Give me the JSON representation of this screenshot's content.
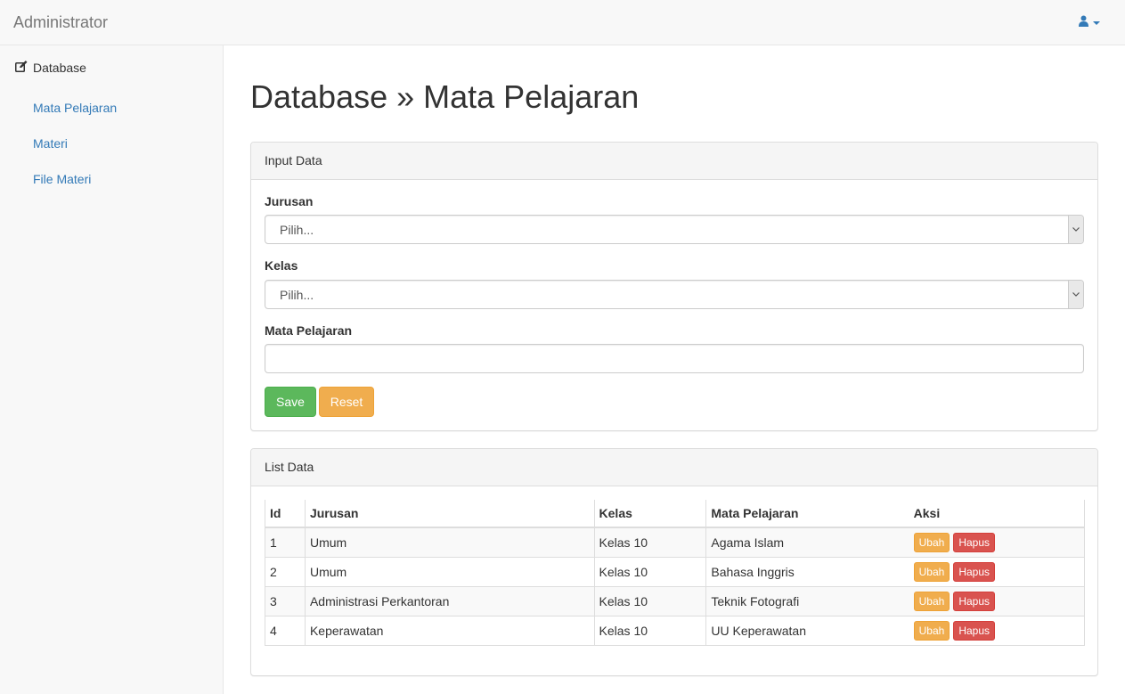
{
  "navbar": {
    "brand": "Administrator",
    "user_icon": "user-icon",
    "caret_icon": "caret-down-icon",
    "accent": "#337ab7"
  },
  "sidebar": {
    "heading": {
      "icon": "edit-icon",
      "label": "Database"
    },
    "items": [
      {
        "label": "Mata Pelajaran"
      },
      {
        "label": "Materi"
      },
      {
        "label": "File Materi"
      }
    ]
  },
  "main": {
    "title": "Database » Mata Pelajaran",
    "input_panel": {
      "heading": "Input Data",
      "jurusan_label": "Jurusan",
      "jurusan_value": "Pilih...",
      "kelas_label": "Kelas",
      "kelas_value": "Pilih...",
      "mapel_label": "Mata Pelajaran",
      "mapel_value": "",
      "save_label": "Save",
      "reset_label": "Reset"
    },
    "list_panel": {
      "heading": "List Data",
      "columns": [
        "Id",
        "Jurusan",
        "Kelas",
        "Mata Pelajaran",
        "Aksi"
      ],
      "rows": [
        {
          "id": "1",
          "jurusan": "Umum",
          "kelas": "Kelas 10",
          "mapel": "Agama Islam",
          "ubah": "Ubah",
          "hapus": "Hapus"
        },
        {
          "id": "2",
          "jurusan": "Umum",
          "kelas": "Kelas 10",
          "mapel": "Bahasa Inggris",
          "ubah": "Ubah",
          "hapus": "Hapus"
        },
        {
          "id": "3",
          "jurusan": "Administrasi Perkantoran",
          "kelas": "Kelas 10",
          "mapel": "Teknik Fotografi",
          "ubah": "Ubah",
          "hapus": "Hapus"
        },
        {
          "id": "4",
          "jurusan": "Keperawatan",
          "kelas": "Kelas 10",
          "mapel": "UU Keperawatan",
          "ubah": "Ubah",
          "hapus": "Hapus"
        }
      ]
    }
  },
  "colors": {
    "success": "#5cb85c",
    "warning": "#f0ad4e",
    "danger": "#d9534f",
    "link": "#337ab7"
  }
}
